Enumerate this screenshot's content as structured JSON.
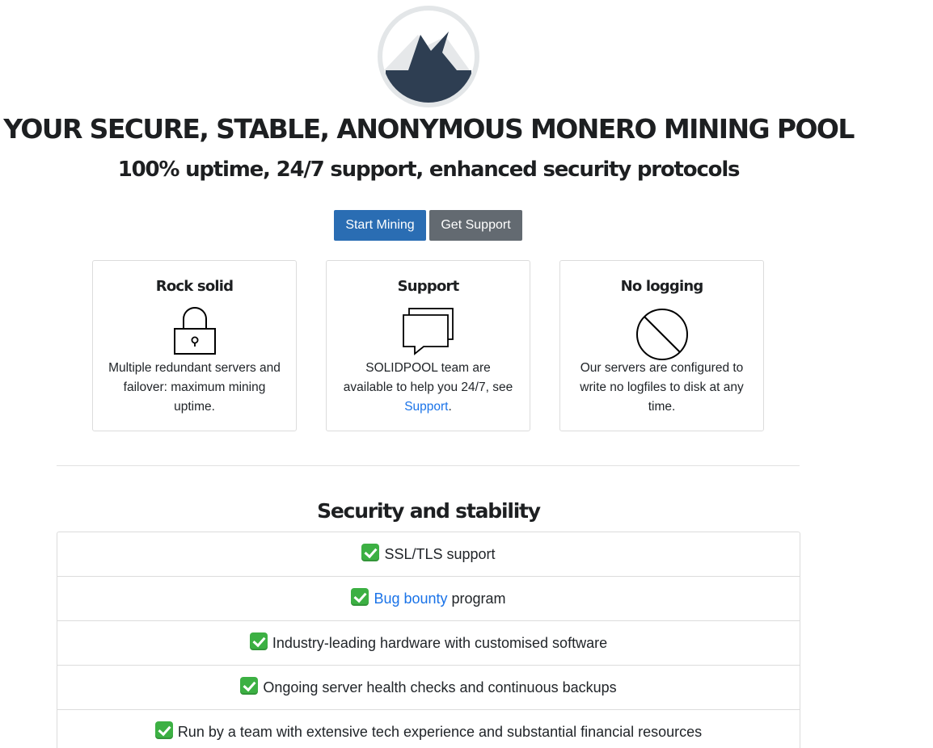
{
  "header": {
    "headline": "YOUR SECURE, STABLE, ANONYMOUS MONERO MINING POOL",
    "subheadline": "100% uptime, 24/7 support, enhanced security protocols",
    "logo_icon": "mountain-bird-logo-icon"
  },
  "actions": {
    "start_label": "Start Mining",
    "support_label": "Get Support"
  },
  "cards": [
    {
      "title": "Rock solid",
      "icon": "padlock-icon",
      "text": "Multiple redundant servers and failover: maximum mining uptime."
    },
    {
      "title": "Support",
      "icon": "chat-bubbles-icon",
      "text_before": "SOLIDPOOL team are available to help you 24/7, see ",
      "link": "Support",
      "text_after": "."
    },
    {
      "title": "No logging",
      "icon": "prohibited-icon",
      "text": "Our servers are configured to write no logfiles to disk at any time."
    }
  ],
  "security": {
    "title": "Security and stability",
    "items": [
      {
        "text": "SSL/TLS support"
      },
      {
        "link": "Bug bounty",
        "text": " program"
      },
      {
        "text": "Industry-leading hardware with customised software"
      },
      {
        "text": "Ongoing server health checks and continuous backups"
      },
      {
        "text": "Run by a team with extensive tech experience and substantial financial resources"
      }
    ]
  },
  "colors": {
    "primary_button": "#2a6db3",
    "secondary_button": "#636a71",
    "link": "#1a73e8",
    "check": "#3cb043",
    "logo_dark": "#2e3e52"
  }
}
